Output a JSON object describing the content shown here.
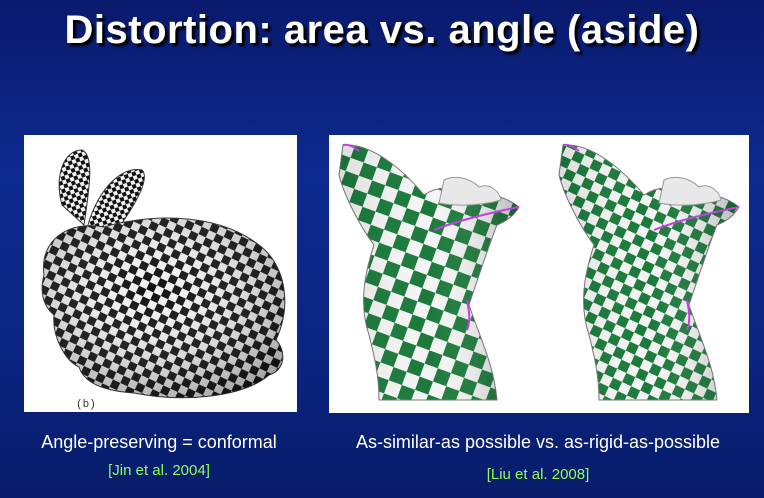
{
  "slide": {
    "title": "Distortion: area vs. angle (aside)",
    "left": {
      "figure_label": "(b)",
      "caption": "Angle-preserving = conformal",
      "citation": "[Jin et al. 2004]"
    },
    "right": {
      "caption": "As-similar-as possible vs. as-rigid-as-possible",
      "citation": "[Liu et al. 2008]"
    },
    "colors": {
      "background": "#0a2480",
      "citation": "#8cff5a",
      "checker_green": "#1a7a3a",
      "seam": "#c040e0"
    }
  }
}
